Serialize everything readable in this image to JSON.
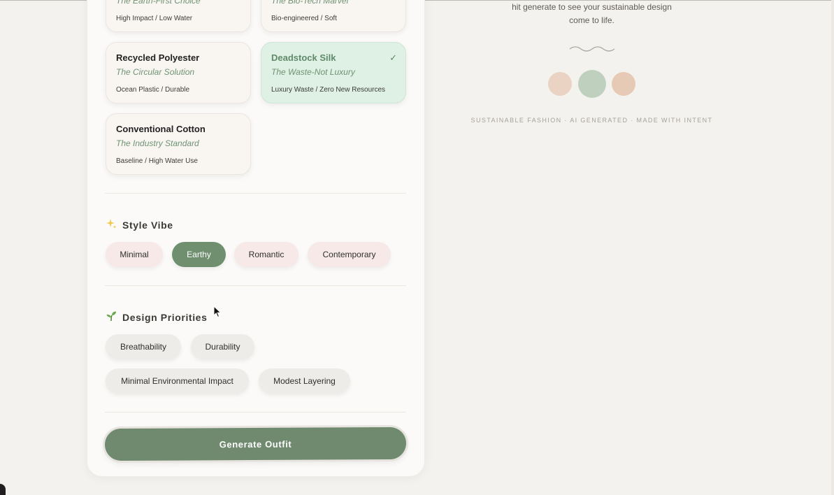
{
  "fabrics": [
    {
      "title": "The Earth-First Choice",
      "meta": "High Impact / Low Water"
    },
    {
      "title": "The Bio-Tech Marvel",
      "meta": "Bio-engineered / Soft"
    },
    {
      "name": "Recycled Polyester",
      "subtitle": "The Circular Solution",
      "meta": "Ocean Plastic / Durable",
      "selected": false
    },
    {
      "name": "Deadstock Silk",
      "subtitle": "The Waste-Not Luxury",
      "meta": "Luxury Waste / Zero New Resources",
      "selected": true
    },
    {
      "name": "Conventional Cotton",
      "subtitle": "The Industry Standard",
      "meta": "Baseline / High Water Use",
      "selected": false
    }
  ],
  "check_icon": "✓",
  "style_vibe": {
    "title": "Style Vibe",
    "icon": "sparkles-icon",
    "options": [
      "Minimal",
      "Earthy",
      "Romantic",
      "Contemporary"
    ],
    "selected": "Earthy"
  },
  "design_priorities": {
    "title": "Design Priorities",
    "icon": "sprout-icon",
    "options": [
      "Breathability",
      "Durability",
      "Minimal Environmental Impact",
      "Modest Layering"
    ]
  },
  "generate_label": "Generate Outfit",
  "intro": {
    "line1": "hit generate to see your sustainable design",
    "line2": "come to life."
  },
  "palette": [
    "#ead3c2",
    "#bfd0bf",
    "#e6cab5"
  ],
  "footer": "SUSTAINABLE FASHION · AI GENERATED · MADE WITH INTENT",
  "colors": {
    "accent": "#6f8a6e",
    "selected_card": "#dff0e4",
    "chip_pink": "#f6e9e8"
  }
}
